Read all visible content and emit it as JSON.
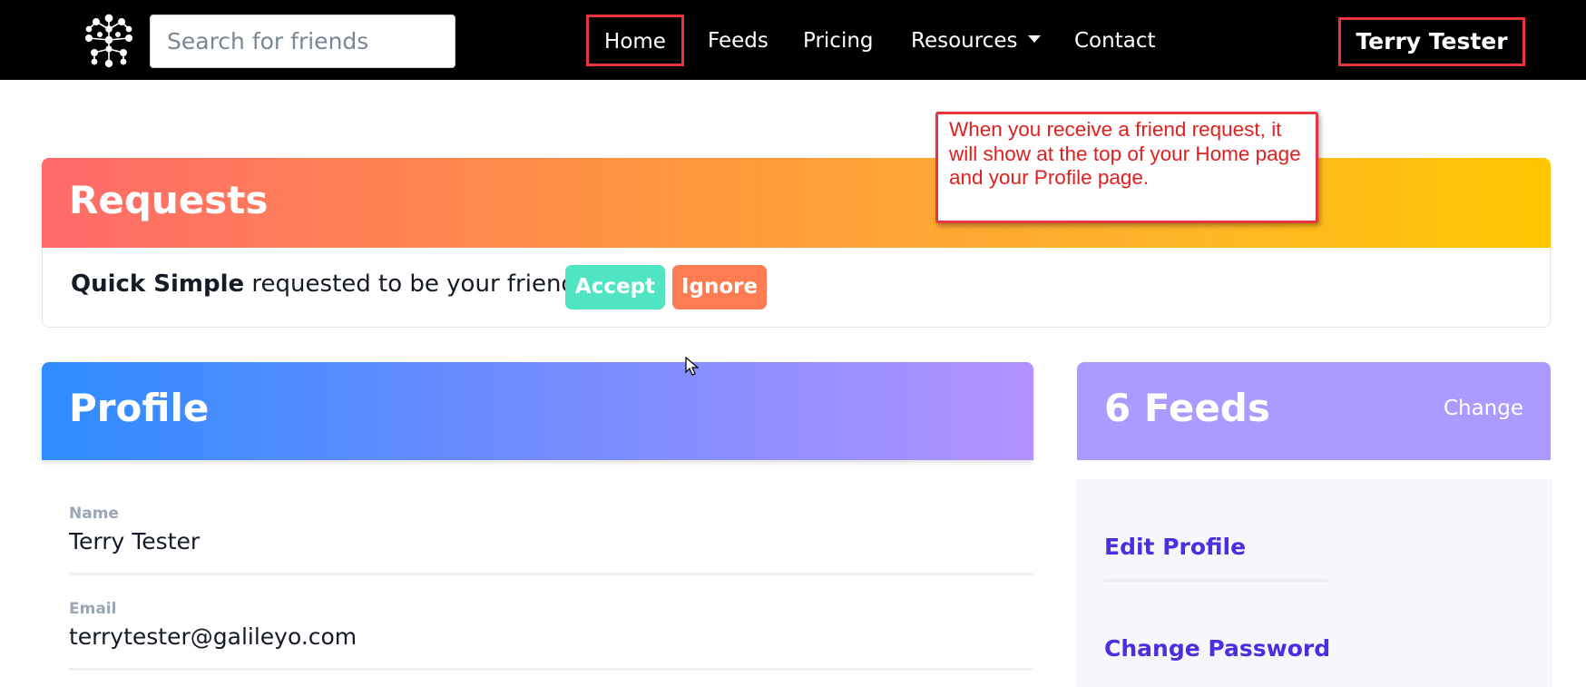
{
  "navbar": {
    "search_placeholder": "Search for friends",
    "links": [
      "Home",
      "Feeds",
      "Pricing",
      "Resources",
      "Contact"
    ],
    "user_name": "Terry Tester",
    "logo_icon": "network-logo-icon"
  },
  "callout": {
    "text": "When you receive a friend request, it will show at the top of your Home page and your Profile page."
  },
  "requests": {
    "title": "Requests",
    "requester_name": "Quick Simple",
    "request_text": " requested to be your friend.",
    "accept_label": "Accept",
    "ignore_label": "Ignore",
    "colors": {
      "accept": "#4fe5c2",
      "ignore": "#ff7b52"
    }
  },
  "profile": {
    "title": "Profile",
    "fields": [
      {
        "label": "Name",
        "value": "Terry Tester"
      },
      {
        "label": "Email",
        "value": "terrytester@galileyo.com"
      }
    ]
  },
  "feeds": {
    "title": "6 Feeds",
    "change_label": "Change",
    "menu": [
      "Edit Profile",
      "Change Password"
    ]
  },
  "colors": {
    "annotation_red": "#e8353f",
    "link_purple": "#4a2fe0"
  }
}
